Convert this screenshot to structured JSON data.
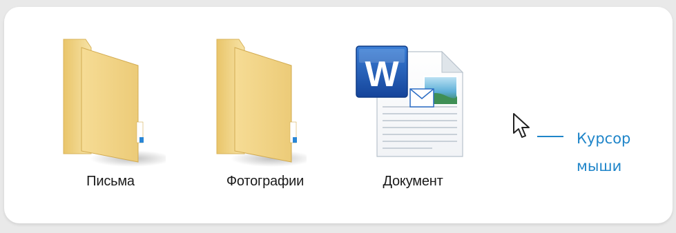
{
  "desktop": {
    "items": [
      {
        "label": "Письма",
        "icon": "folder-icon"
      },
      {
        "label": "Фотографии",
        "icon": "folder-icon"
      },
      {
        "label": "Документ",
        "icon": "word-document-icon"
      }
    ]
  },
  "callout": {
    "line1": "Курсор",
    "line2": "мыши"
  },
  "colors": {
    "callout": "#1f85c9",
    "folder": "#f3d88f",
    "word_blue": "#1d5ab0"
  }
}
